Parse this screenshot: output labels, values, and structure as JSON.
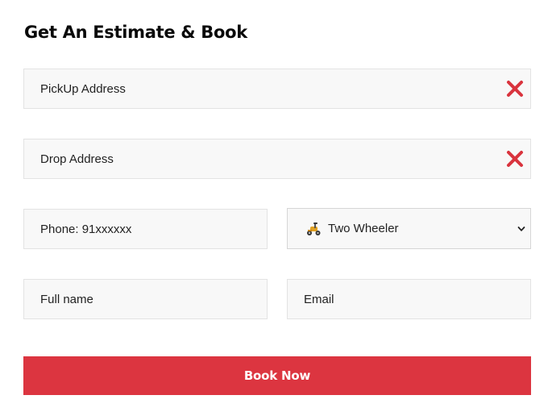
{
  "form": {
    "title": "Get An Estimate & Book",
    "pickup": {
      "placeholder": "PickUp Address",
      "clear_icon": "close-icon"
    },
    "drop": {
      "placeholder": "Drop Address",
      "clear_icon": "close-icon"
    },
    "phone": {
      "placeholder": "Phone: 91xxxxxx"
    },
    "vehicle": {
      "selected": "Two Wheeler",
      "icon": "scooter-icon"
    },
    "full_name": {
      "placeholder": "Full name"
    },
    "email": {
      "placeholder": "Email"
    },
    "submit_label": "Book Now"
  },
  "colors": {
    "accent": "#dc3540",
    "clear_icon": "#d9343e",
    "field_bg": "#f8f8f8",
    "field_border": "#e3e3e3"
  }
}
